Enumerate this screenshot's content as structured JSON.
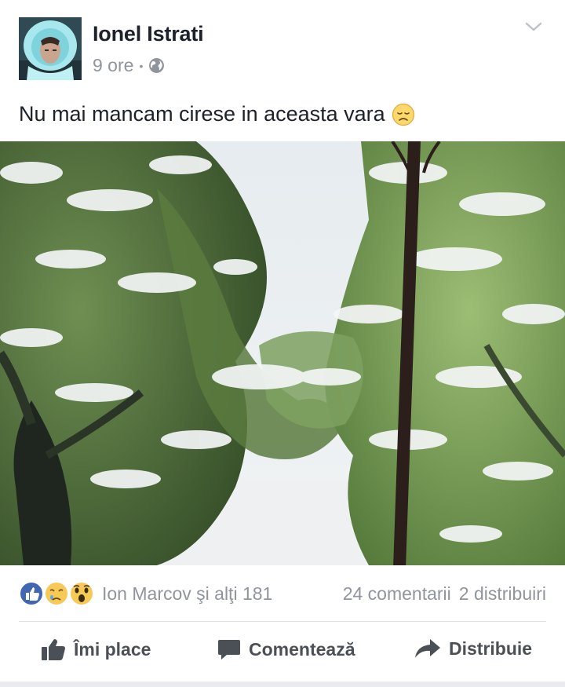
{
  "post": {
    "author": "Ionel Istrati",
    "time": "9 ore",
    "separator": "•",
    "privacy_icon": "globe-icon",
    "text": "Nu mai mancam cirese in aceasta vara",
    "emoji": "disappointed-face-emoji",
    "menu_icon": "chevron-down-icon"
  },
  "stats": {
    "reaction_icons": [
      "like-reaction-icon",
      "sad-reaction-icon",
      "wow-reaction-icon"
    ],
    "reactors": "Ion Marcov şi alţi 181",
    "comments": "24 comentarii",
    "shares": "2 distribuiri"
  },
  "actions": {
    "like": "Îmi place",
    "comment": "Comentează",
    "share": "Distribuie"
  },
  "colors": {
    "accent": "#4267b2",
    "text": "#1d2129",
    "muted": "#90949c",
    "action": "#4b4f56"
  }
}
